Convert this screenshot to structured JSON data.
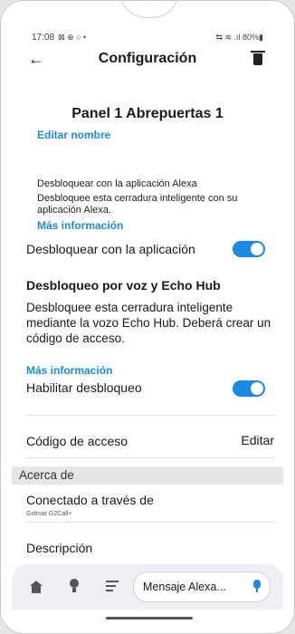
{
  "status": {
    "time": "17:08",
    "left_icons": "⊠ ⊕ ○ •",
    "right": "⇆ ≋ .ıl 80%▮"
  },
  "header": {
    "title": "Configuración"
  },
  "device": {
    "name": "Panel 1 Abrepuertas 1",
    "edit_name_link": "Editar nombre"
  },
  "alexa_unlock": {
    "heading": "Desbloquear con la aplicación Alexa",
    "description": "Desbloquee esta cerradura inteligente con su aplicación Alexa.",
    "more_link": "Más información",
    "toggle_label": "Desbloquear con la aplicación",
    "toggle_on": true
  },
  "voice_unlock": {
    "title": "Desbloqueo por voz y Echo Hub",
    "description": "Desbloquee esta cerradura inteligente mediante la vozo Echo Hub. Deberá crear un código de acceso.",
    "more_link": "Más información",
    "toggle_label": "Habilitar desbloqueo",
    "toggle_on": true
  },
  "access_code": {
    "label": "Código de acceso",
    "edit": "Editar"
  },
  "about": {
    "section_label": "Acerca de",
    "connected_label": "Conectado a través de",
    "connected_value": "Golmar G2Call+",
    "description_label": "Descripción"
  },
  "bottom_bar": {
    "message_placeholder": "Mensaje Alexa..."
  },
  "colors": {
    "accent": "#1a8be0",
    "background": "#ffffff",
    "section_band": "#e6e6e6"
  },
  "icons": [
    "back-arrow-icon",
    "trash-icon",
    "home-icon",
    "bulb-icon",
    "menu-icon",
    "mic-icon"
  ]
}
